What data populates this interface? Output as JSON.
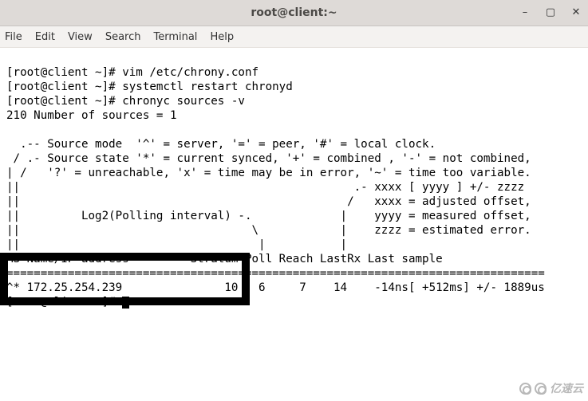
{
  "window": {
    "title": "root@client:~",
    "minimize_icon": "–",
    "maximize_icon": "▢",
    "close_icon": "✕"
  },
  "menu": {
    "file": "File",
    "edit": "Edit",
    "view": "View",
    "search": "Search",
    "terminal": "Terminal",
    "help": "Help"
  },
  "terminal_lines": {
    "l0": "[root@client ~]# vim /etc/chrony.conf",
    "l1": "[root@client ~]# systemctl restart chronyd",
    "l2": "[root@client ~]# chronyc sources -v",
    "l3": "210 Number of sources = 1",
    "l4": "",
    "l5": "  .-- Source mode  '^' = server, '=' = peer, '#' = local clock.",
    "l6": " / .- Source state '*' = current synced, '+' = combined , '-' = not combined,",
    "l7": "| /   '?' = unreachable, 'x' = time may be in error, '~' = time too variable.",
    "l8": "||                                                 .- xxxx [ yyyy ] +/- zzzz",
    "l9": "||                                                /   xxxx = adjusted offset,",
    "l10": "||         Log2(Polling interval) -.             |    yyyy = measured offset,",
    "l11": "||                                  \\            |    zzzz = estimated error.",
    "l12": "||                                   |           |",
    "l13": "MS Name/IP address         Stratum Poll Reach LastRx Last sample",
    "l14": "===============================================================================",
    "l15": "^* 172.25.254.239               10   6     7    14    -14ns[ +512ms] +/- 1889us",
    "l16": "[root@client ~]# "
  },
  "watermark": {
    "text": "亿速云"
  }
}
